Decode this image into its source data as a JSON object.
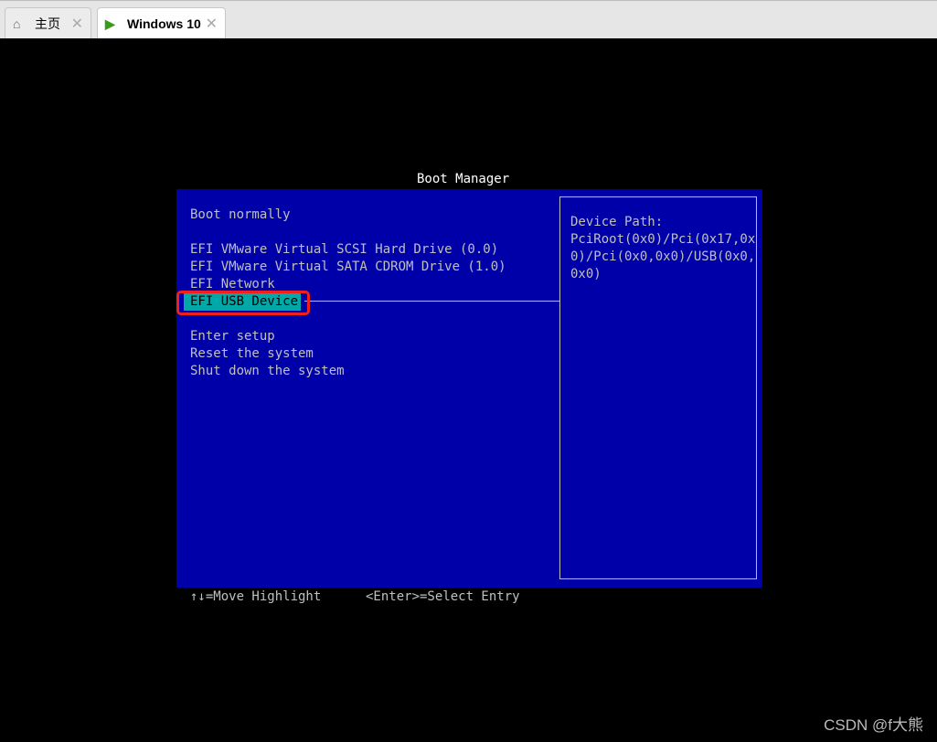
{
  "tabs": [
    {
      "label": "主页",
      "icon": "home-icon"
    },
    {
      "label": "Windows 10",
      "icon": "vm-icon"
    }
  ],
  "close": "✕",
  "boot": {
    "title": "Boot Manager",
    "items": [
      "Boot normally",
      "EFI VMware Virtual SCSI Hard Drive (0.0)",
      "EFI VMware Virtual SATA CDROM Drive (1.0)",
      "EFI Network",
      "EFI USB Device",
      "Enter setup",
      "Reset the system",
      "Shut down the system"
    ],
    "device_path": "Device Path:\nPciRoot(0x0)/Pci(0x17,0x\n0)/Pci(0x0,0x0)/USB(0x0,\n0x0)",
    "help_move": "↑↓=Move Highlight",
    "help_select": "<Enter>=Select Entry"
  },
  "watermark": "CSDN @f大熊"
}
